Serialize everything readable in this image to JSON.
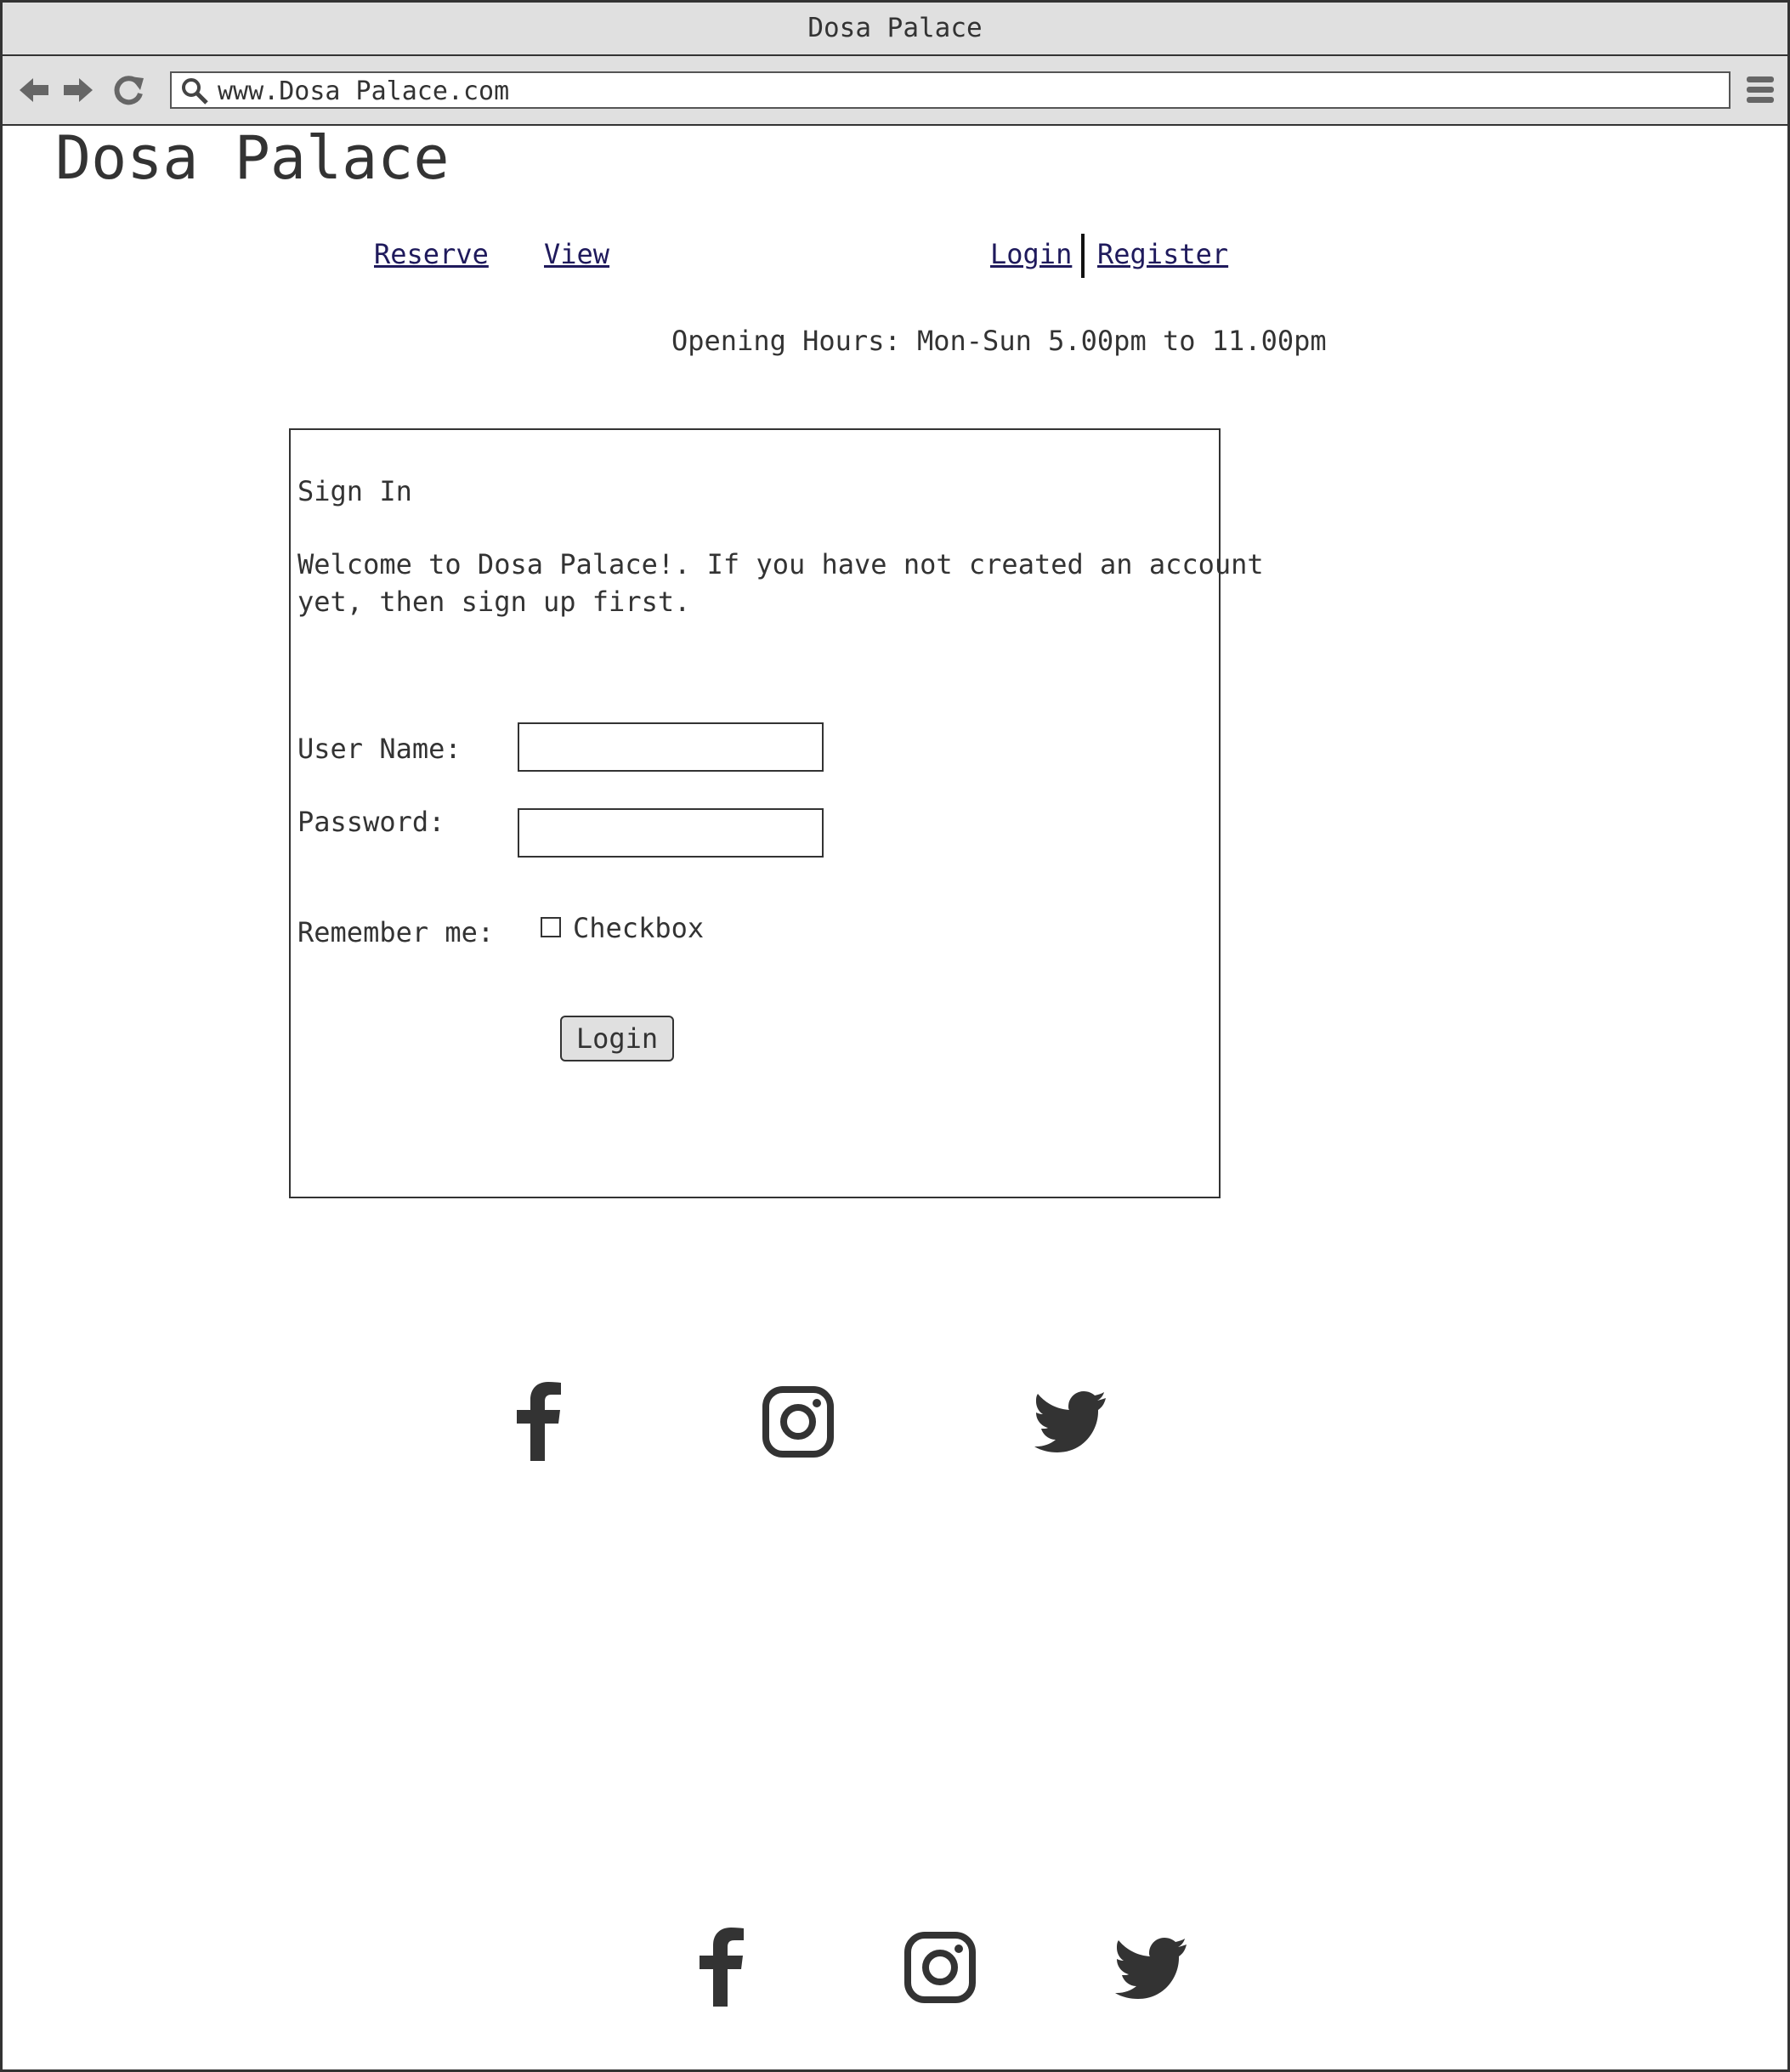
{
  "window": {
    "title": "Dosa Palace"
  },
  "browser": {
    "url": "www.Dosa Palace.com",
    "icons": [
      "back-arrow-icon",
      "forward-arrow-icon",
      "reload-icon",
      "search-icon",
      "hamburger-menu-icon"
    ]
  },
  "site": {
    "title": "Dosa Palace",
    "nav": {
      "reserve": "Reserve",
      "view": "View",
      "login": "Login",
      "register": "Register"
    },
    "hours": "Opening Hours: Mon-Sun 5.00pm to 11.00pm"
  },
  "signin": {
    "heading": "Sign In",
    "welcome_line1": "Welcome to Dosa Palace!. If you have not created an account",
    "welcome_line2": "yet, then sign up first.",
    "username_label": "User Name:",
    "username_value": "",
    "password_label": "Password:",
    "password_value": "",
    "remember_label": "Remember me:",
    "checkbox_label": "Checkbox",
    "remember_checked": false,
    "login_button": "Login"
  },
  "social": {
    "icons": [
      "facebook-icon",
      "instagram-icon",
      "twitter-icon"
    ]
  },
  "colors": {
    "chrome_bg": "#e0e0e0",
    "link": "#1f1a5c",
    "text": "#333333",
    "border": "#333333"
  }
}
